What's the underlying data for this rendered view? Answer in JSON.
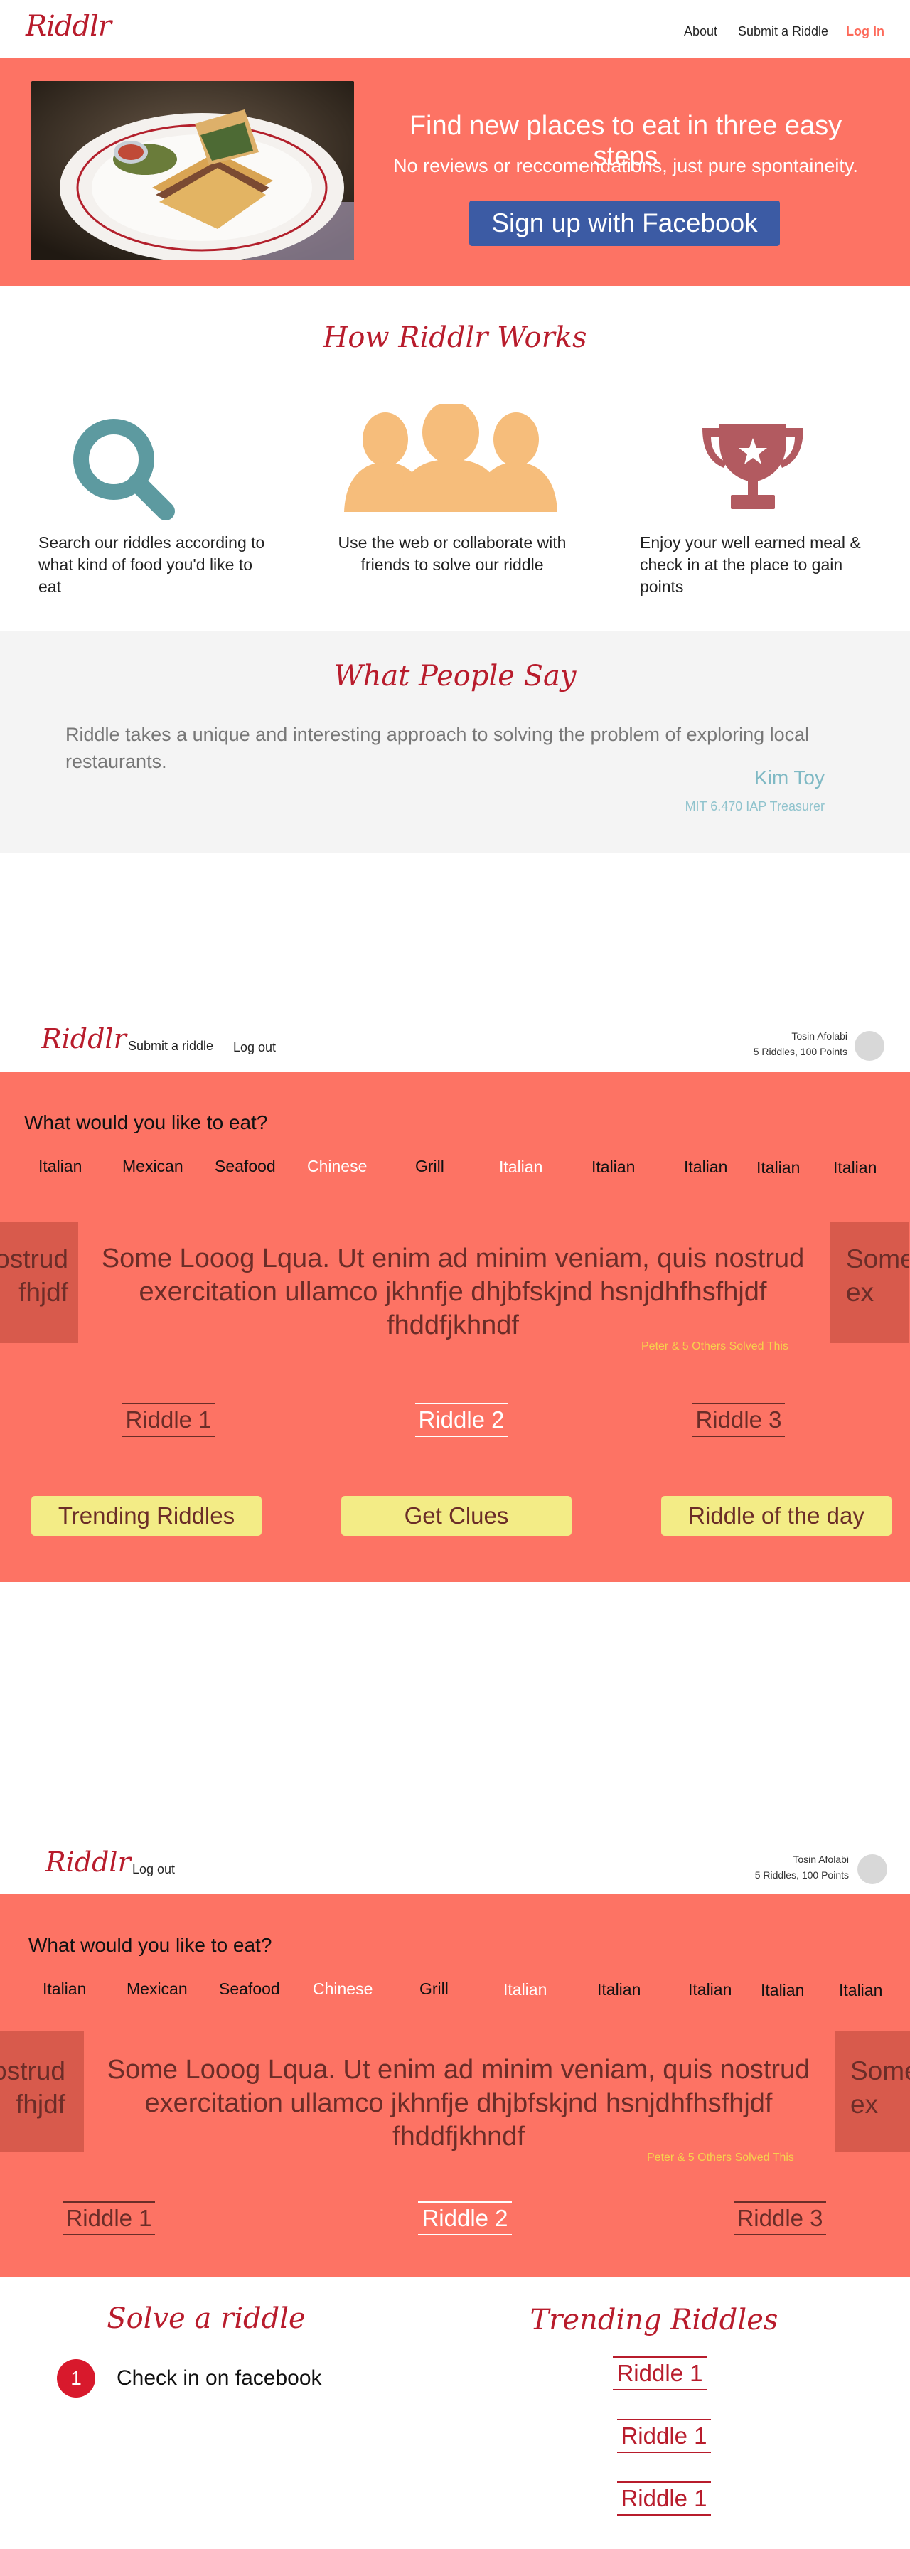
{
  "landing": {
    "nav": {
      "logo": "Riddlr",
      "links": [
        "About",
        "Submit a Riddle"
      ],
      "login": "Log In"
    },
    "hero": {
      "title": "Find new places to eat in three easy steps",
      "subtitle": "No reviews or reccomendations,  just pure spontaineity.",
      "cta": "Sign up with Facebook"
    },
    "how": {
      "title": "How Riddlr Works",
      "steps": [
        {
          "icon": "search-icon",
          "text": "Search our riddles according to what kind of food you'd like to eat"
        },
        {
          "icon": "people-icon",
          "text": "Use the web or collaborate with friends to solve our riddle"
        },
        {
          "icon": "trophy-icon",
          "text": "Enjoy your well earned meal & check in at the place to gain points"
        }
      ]
    },
    "testimonials": {
      "title": "What People Say",
      "quote": "Riddle takes a unique and  interesting approach to solving the problem of exploring local restaurants.",
      "name": "Kim Toy",
      "role": "MIT 6.470 IAP Treasurer"
    }
  },
  "browse": {
    "nav": {
      "logo": "Riddlr",
      "links": [
        "Submit a riddle",
        "Log out"
      ],
      "user_name": "Tosin Afolabi",
      "user_stats": "5 Riddles, 100 Points"
    },
    "question": "What would you like to eat?",
    "categories": [
      "Italian",
      "Mexican",
      "Seafood",
      "Chinese",
      "Grill",
      "Italian",
      "Italian",
      "Italian",
      "Italian",
      "Italian"
    ],
    "side_left": "ostrud\nfhjdf",
    "side_right": "Some\nex",
    "riddle_text": "Some Looog Lqua. Ut enim ad minim veniam, quis nostrud exercitation ullamco jkhnfje dhjbfskjnd hsnjdhfhsfhjdf fhddfjkhndf",
    "solved": "Peter & 5 Others Solved This",
    "riddles": [
      "Riddle 1",
      "Riddle 2",
      "Riddle 3"
    ],
    "buttons": [
      "Trending Riddles",
      "Get Clues",
      "Riddle of the day"
    ]
  },
  "solve": {
    "nav": {
      "logo": "Riddlr",
      "links": [
        "Log out"
      ],
      "user_name": "Tosin Afolabi",
      "user_stats": "5 Riddles, 100 Points"
    },
    "question": "What would you like to eat?",
    "categories": [
      "Italian",
      "Mexican",
      "Seafood",
      "Chinese",
      "Grill",
      "Italian",
      "Italian",
      "Italian",
      "Italian",
      "Italian"
    ],
    "side_left": "ostrud\nfhjdf",
    "side_right": "Some\nex",
    "riddle_text": "Some Looog Lqua. Ut enim ad minim veniam, quis nostrud exercitation ullamco jkhnfje dhjbfskjnd hsnjdhfhsfhjdf fhddfjkhndf",
    "solved": "Peter & 5 Others Solved This",
    "riddles": [
      "Riddle 1",
      "Riddle 2",
      "Riddle 3"
    ],
    "solve_title": "Solve a riddle",
    "steps": [
      {
        "num": "1",
        "text": "Check in on facebook"
      }
    ],
    "trending_title": "Trending Riddles",
    "trending": [
      "Riddle 1",
      "Riddle 1",
      "Riddle 1"
    ]
  },
  "colors": {
    "brand_red": "#b81c2c",
    "salmon": "#fd7364",
    "facebook_blue": "#3c5ba4",
    "button_yellow": "#f3ec86"
  }
}
